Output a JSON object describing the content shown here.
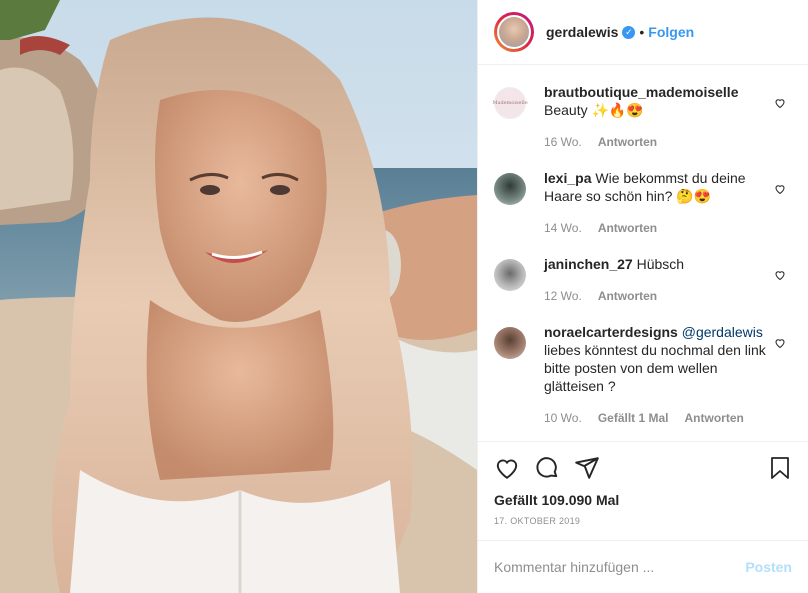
{
  "header": {
    "username": "gerdalewis",
    "follow": "Folgen",
    "verified_mark": "✓",
    "separator": "•"
  },
  "comments": [
    {
      "user": "brautboutique_mademoiselle",
      "text": "Beauty ✨🔥😍",
      "age": "16 Wo.",
      "reply": "Antworten",
      "likes": "",
      "avatar_color": "#f3e5e8",
      "avatar_text": "Mademoiselle"
    },
    {
      "user": "lexi_pa",
      "text": "Wie bekommst du deine Haare so schön hin? 🤔😍",
      "age": "14 Wo.",
      "reply": "Antworten",
      "likes": "",
      "avatar_color": "#7a8a84"
    },
    {
      "user": "janinchen_27",
      "text": "Hübsch",
      "age": "12 Wo.",
      "reply": "Antworten",
      "likes": "",
      "avatar_color": "#b9b9b9"
    },
    {
      "user": "noraelcarterdesigns",
      "mention": "@gerdalewis",
      "text": "liebes könntest du nochmal den link bitte posten von dem wellen glätteisen ?",
      "age": "10 Wo.",
      "likes": "Gefällt 1 Mal",
      "reply": "Antworten",
      "avatar_color": "#a07e6e"
    }
  ],
  "actions": {
    "likes": "Gefällt 109.090 Mal",
    "date": "17. OKTOBER 2019"
  },
  "composer": {
    "placeholder": "Kommentar hinzufügen ...",
    "post": "Posten"
  },
  "icons": [
    "heart-icon",
    "comment-icon",
    "share-icon",
    "bookmark-icon"
  ]
}
